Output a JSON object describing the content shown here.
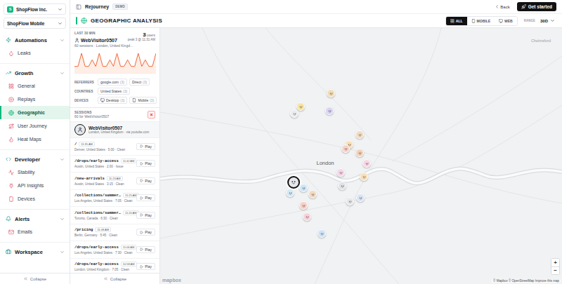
{
  "workspace": {
    "avatar": "S",
    "name": "ShopFlow Inc.",
    "project": "ShopFlow Mobile"
  },
  "sidebar": {
    "groups": [
      {
        "label": "Automations",
        "expanded": true,
        "items": [
          {
            "label": "Leaks",
            "selected": false
          }
        ]
      },
      {
        "label": "Growth",
        "expanded": true,
        "items": [
          {
            "label": "General",
            "selected": false
          },
          {
            "label": "Replays",
            "selected": false
          },
          {
            "label": "Geographic",
            "selected": true
          },
          {
            "label": "User Journey",
            "selected": false
          },
          {
            "label": "Heat Maps",
            "selected": false
          }
        ]
      },
      {
        "label": "Developer",
        "expanded": true,
        "items": [
          {
            "label": "Stability",
            "selected": false
          },
          {
            "label": "API Insights",
            "selected": false
          },
          {
            "label": "Devices",
            "selected": false
          }
        ]
      },
      {
        "label": "Alerts",
        "expanded": true,
        "items": [
          {
            "label": "Emails",
            "selected": false
          }
        ]
      },
      {
        "label": "Workspace",
        "expanded": true,
        "items": []
      }
    ],
    "collapse": "Collapse"
  },
  "header": {
    "brand": "Rejourney",
    "badge": "DEMO",
    "back": "Back",
    "cta": "Get started"
  },
  "title": "GEOGRAPHIC ANALYSIS",
  "filters": [
    {
      "label": "ALL",
      "selected": true
    },
    {
      "label": "MOBILE",
      "selected": false
    },
    {
      "label": "WEB",
      "selected": false
    }
  ],
  "range": {
    "label": "RANGE",
    "value": "30D"
  },
  "summary": {
    "window": "LAST 30 MIN",
    "users": "3",
    "users_label": "users",
    "peak": "peak 3 @ 11:31 AM",
    "visitor": "WebVisitor0507",
    "detail": "60 sessions · London, United Kingd…"
  },
  "chart": {
    "values": [
      1,
      1,
      3,
      1,
      1,
      2,
      1,
      3,
      1,
      1,
      2,
      1,
      3,
      1,
      1,
      2,
      1,
      1,
      3,
      1,
      2,
      1,
      1,
      3
    ],
    "max": 3
  },
  "breakdowns": [
    {
      "label": "REFERRERS",
      "chips": [
        {
          "kind": "plain",
          "label": "google.com",
          "count": "(3)"
        },
        {
          "kind": "plain",
          "label": "Direct",
          "count": "(3)"
        }
      ]
    },
    {
      "label": "COUNTRIES",
      "chips": [
        {
          "kind": "plain",
          "label": "United States",
          "count": "(3)"
        }
      ]
    },
    {
      "label": "DEVICES",
      "chips": [
        {
          "kind": "desktop",
          "label": "Desktop",
          "count": "(3)"
        },
        {
          "kind": "mobile",
          "label": "Mobile",
          "count": "(3)"
        }
      ]
    }
  ],
  "sessions": {
    "title": "SESSIONS",
    "subtitle": "60 for WebVisitor0507",
    "close": "×",
    "user": {
      "name": "WebVisitor0507",
      "detail": "London, United Kingdom · via youtube.com"
    },
    "rows": [
      {
        "path": "/",
        "time": "11:35 AM",
        "detail": "Denver, United States · 5:00 · Clean",
        "play": "Play"
      },
      {
        "path": "/drops/early-access",
        "time": "11:42 AM",
        "detail": "Austin, United States · 2:00 · Issue",
        "play": "Play"
      },
      {
        "path": "/new-arrivals",
        "time": "11:23 AM",
        "detail": "Austin, United States · 3:15 · Clean",
        "play": "Play"
      },
      {
        "path": "/collections/summer…",
        "time": "11:25 AM",
        "detail": "Los Angeles, United States · 7:05 · Clean",
        "play": "Play"
      },
      {
        "path": "/collections/summer…",
        "time": "11:20 AM",
        "detail": "Toronto, Canada · 6:30 · Clean",
        "play": "Play"
      },
      {
        "path": "/pricing",
        "time": "11:08 AM",
        "detail": "Berlin, Germany · 5:45 · Clean",
        "play": "Play"
      },
      {
        "path": "/drops/early-access",
        "time": "11:06 AM",
        "detail": "Los Angeles, United States · 7:30 · Clean",
        "play": "Play"
      },
      {
        "path": "/drops/early-access",
        "time": "10:58 AM",
        "detail": "London, United Kingdom · 7:05 · Clean",
        "play": "Play"
      }
    ],
    "collapse": "Collapse"
  },
  "map": {
    "labels": [
      {
        "text": "London"
      },
      {
        "text": "Chelmsford"
      }
    ],
    "pins": [
      {
        "color": "#f3dcb6",
        "selected": false
      },
      {
        "color": "#f7e3a1",
        "selected": false
      },
      {
        "color": "#e9ecef",
        "selected": false
      },
      {
        "color": "#d9d4f5",
        "selected": false
      },
      {
        "color": "#f1dcc0",
        "selected": false
      },
      {
        "color": "#fbe0b5",
        "selected": false
      },
      {
        "color": "#f8d3c8",
        "selected": false
      },
      {
        "color": "#f3d1b8",
        "selected": false
      },
      {
        "color": "#f9d6e4",
        "selected": false
      },
      {
        "color": "#f6d4e8",
        "selected": false
      },
      {
        "color": "#f9dfb7",
        "selected": false
      },
      {
        "color": "#dfe3e7",
        "selected": false
      },
      {
        "color": "#e5e7eb",
        "selected": true
      },
      {
        "color": "#cfe5f7",
        "selected": false
      },
      {
        "color": "#d4e8f5",
        "selected": false
      },
      {
        "color": "#f3d9c2",
        "selected": false
      },
      {
        "color": "#f6cfc6",
        "selected": false
      },
      {
        "color": "#e6e8eb",
        "selected": false
      },
      {
        "color": "#d8e4f5",
        "selected": false
      },
      {
        "color": "#f7d1d9",
        "selected": false
      },
      {
        "color": "#cfe3f6",
        "selected": false
      }
    ],
    "zoom_in": "+",
    "zoom_out": "−",
    "logo": "mapbox",
    "attribution": "© Mapbox © OpenStreetMap Improve this map"
  }
}
